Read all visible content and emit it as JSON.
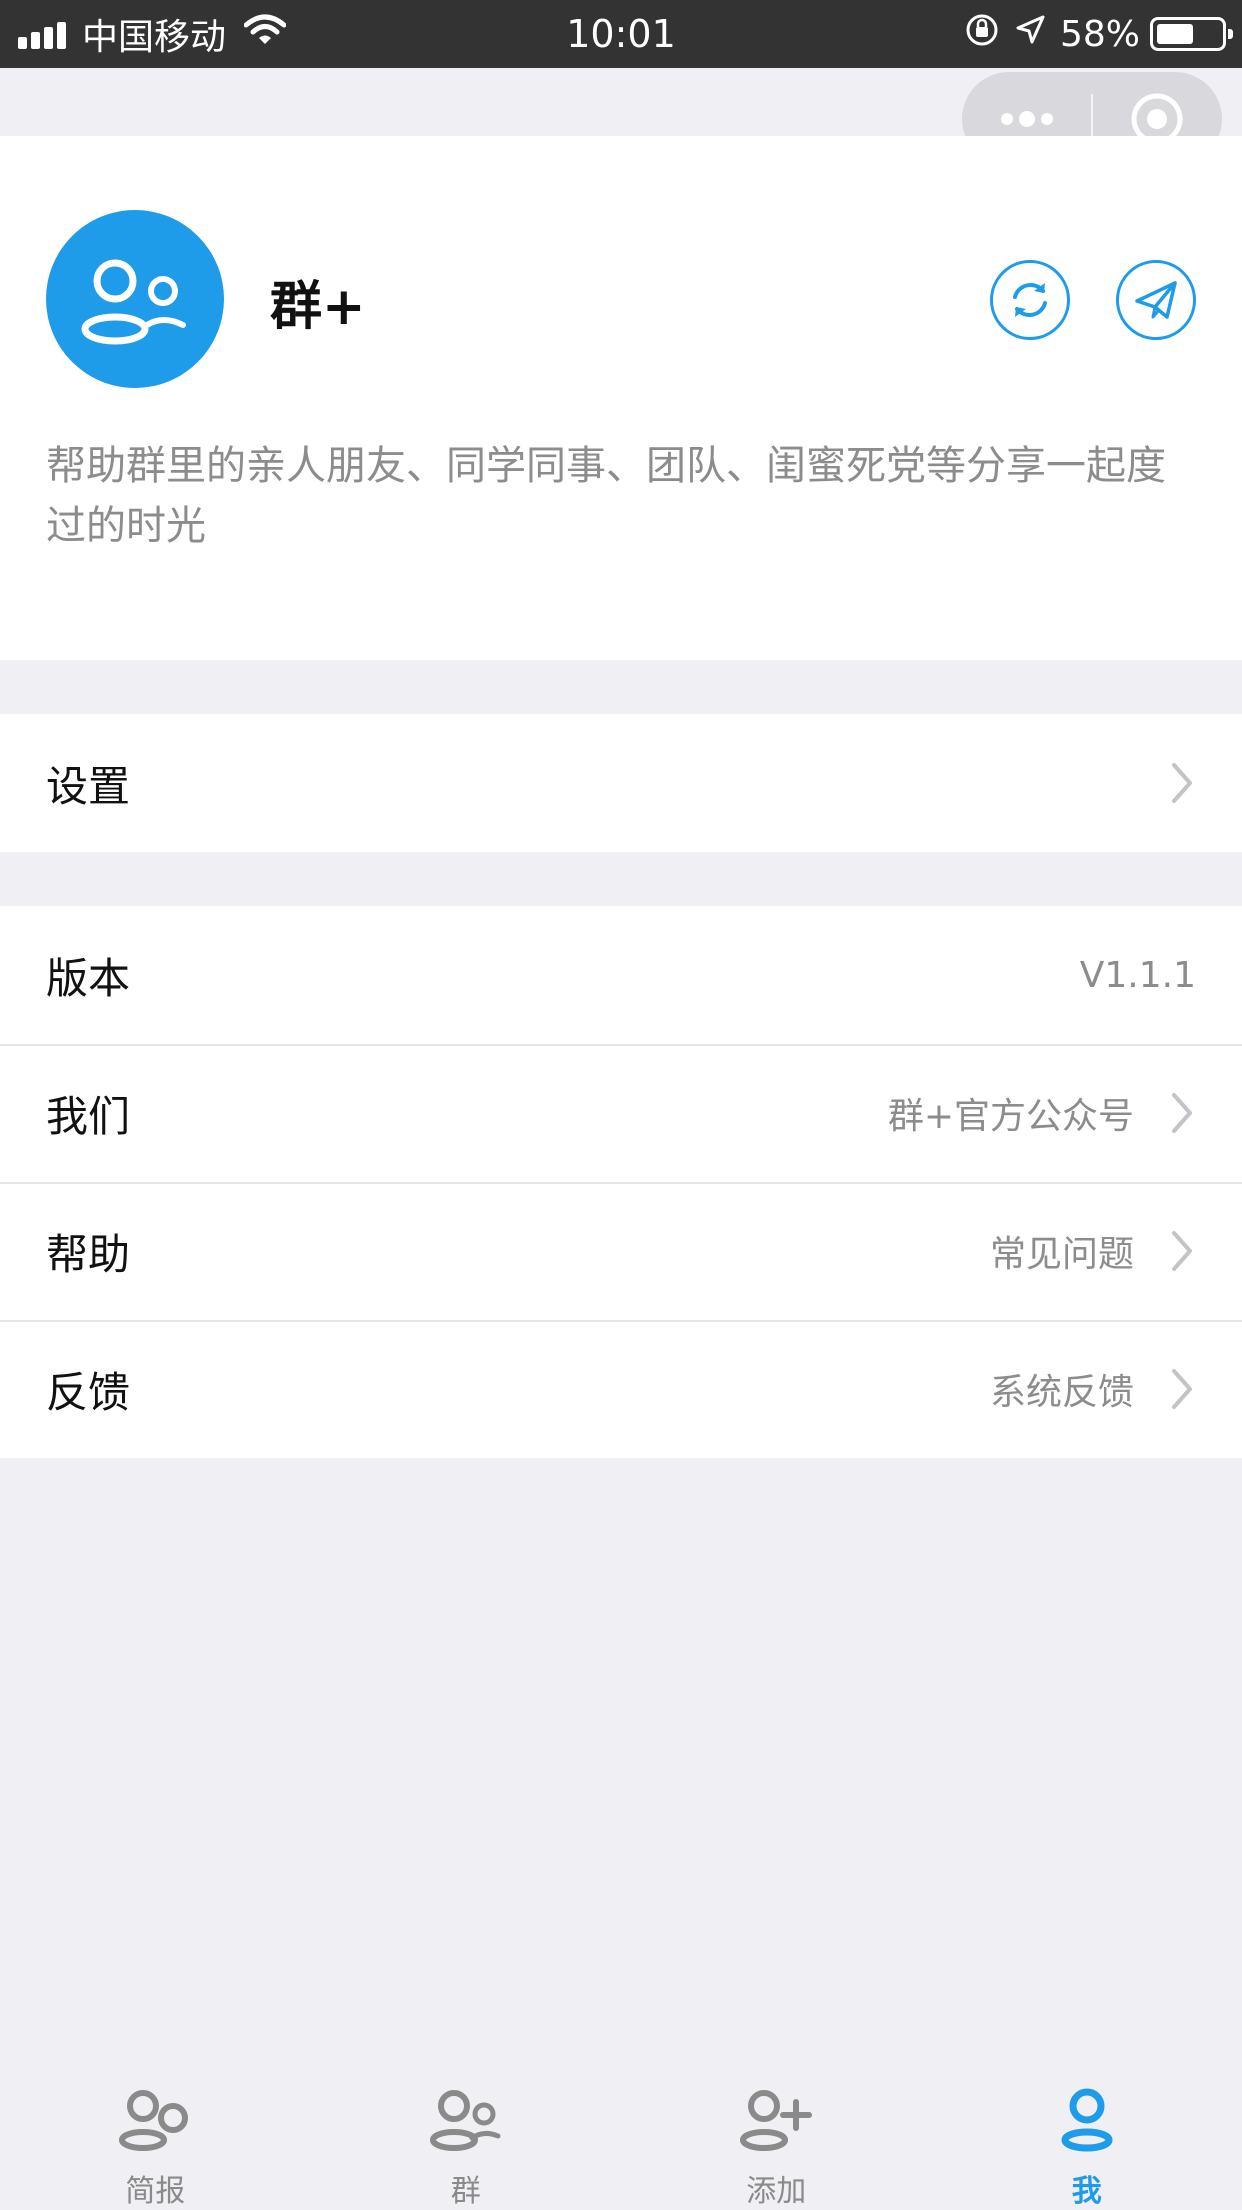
{
  "status_bar": {
    "carrier": "中国移动",
    "time": "10:01",
    "battery_percent_text": "58%",
    "battery_level": 0.58
  },
  "profile": {
    "app_name": "群+",
    "description": "帮助群里的亲人朋友、同学同事、团队、闺蜜死党等分享一起度过的时光"
  },
  "settings_group": {
    "items": [
      {
        "label": "设置",
        "value": ""
      }
    ]
  },
  "info_group": {
    "items": [
      {
        "label": "版本",
        "value": "V1.1.1"
      },
      {
        "label": "我们",
        "value": "群+官方公众号"
      },
      {
        "label": "帮助",
        "value": "常见问题"
      },
      {
        "label": "反馈",
        "value": "系统反馈"
      }
    ]
  },
  "tab_bar": {
    "tabs": [
      {
        "label": "简报",
        "icon": "two-users-icon"
      },
      {
        "label": "群",
        "icon": "group-icon"
      },
      {
        "label": "添加",
        "icon": "add-user-icon"
      },
      {
        "label": "我",
        "icon": "user-icon"
      }
    ],
    "active_index": 3
  },
  "colors": {
    "accent": "#1e9be9",
    "status_bar_bg": "#333333",
    "page_bg": "#efeff4",
    "muted_text": "#8c8c8c"
  }
}
